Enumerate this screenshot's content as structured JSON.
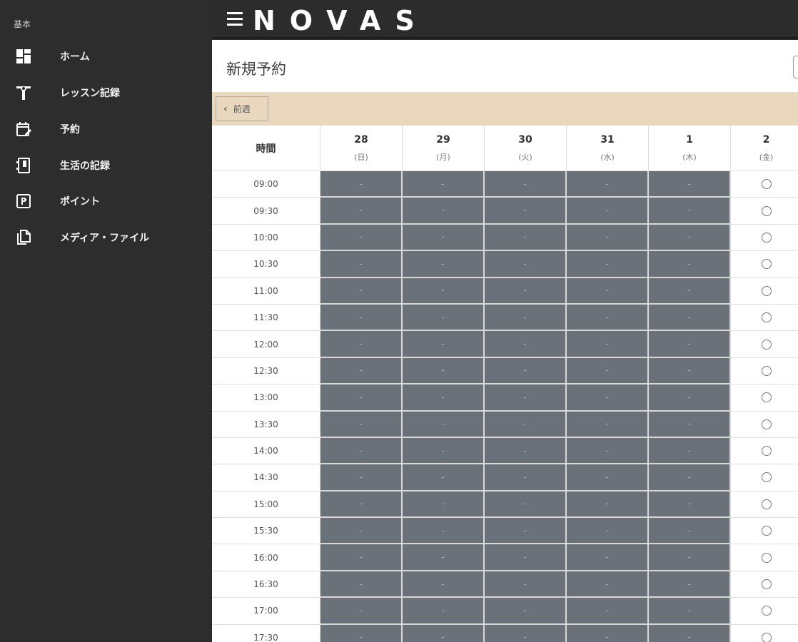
{
  "sidebar": {
    "section": "基本",
    "items": [
      {
        "label": "ホーム",
        "icon": "dashboard-icon"
      },
      {
        "label": "レッスン記録",
        "icon": "fitness-icon"
      },
      {
        "label": "予約",
        "icon": "calendar-edit-icon"
      },
      {
        "label": "生活の記録",
        "icon": "notebook-icon"
      },
      {
        "label": "ポイント",
        "icon": "parking-p-icon"
      },
      {
        "label": "メディア・ファイル",
        "icon": "files-icon"
      }
    ]
  },
  "header": {
    "logo": "NOVAS"
  },
  "main": {
    "title": "新規予約",
    "prev_week_label": "前週",
    "time_header": "時間",
    "days": [
      {
        "num": "28",
        "weekday": "(日)"
      },
      {
        "num": "29",
        "weekday": "(月)"
      },
      {
        "num": "30",
        "weekday": "(火)"
      },
      {
        "num": "31",
        "weekday": "(水)"
      },
      {
        "num": "1",
        "weekday": "(木)"
      },
      {
        "num": "2",
        "weekday": "(金)"
      }
    ],
    "times": [
      "09:00",
      "09:30",
      "10:00",
      "10:30",
      "11:00",
      "11:30",
      "12:00",
      "12:30",
      "13:00",
      "13:30",
      "14:00",
      "14:30",
      "15:00",
      "15:30",
      "16:00",
      "16:30",
      "17:00",
      "17:30"
    ],
    "closed_mark": "-",
    "open_days": [
      5
    ]
  },
  "colors": {
    "sidebar_bg": "#2d2d2d",
    "closed_slot": "#6a7178",
    "week_bar": "#e9d8be"
  }
}
